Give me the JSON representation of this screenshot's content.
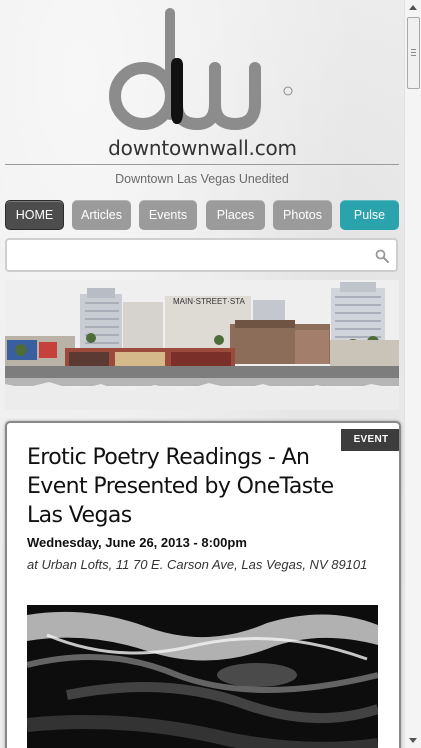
{
  "site": {
    "logo_text": "downtownwall.com",
    "tagline": "Downtown Las Vegas Unedited"
  },
  "nav": {
    "items": [
      {
        "label": "HOME"
      },
      {
        "label": "Articles"
      },
      {
        "label": "Events"
      },
      {
        "label": "Places"
      },
      {
        "label": "Photos"
      },
      {
        "label": "Pulse"
      }
    ]
  },
  "search": {
    "value": "",
    "placeholder": "",
    "icon": "search-icon"
  },
  "banner": {
    "sign_text": "MAIN·STREET·STA"
  },
  "article": {
    "badge": "EVENT",
    "title": "Erotic Poetry Readings - An Event Presented by OneTaste Las Vegas",
    "date": "Wednesday, June 26, 2013 - 8:00pm",
    "location": "at Urban Lofts, 11 70 E. Carson Ave, Las Vegas, NV 89101"
  },
  "colors": {
    "nav_default": "#9b9b9b",
    "nav_active": "#4d4d4d",
    "nav_pulse": "#2aa3ad",
    "badge": "#3d3d3d"
  }
}
